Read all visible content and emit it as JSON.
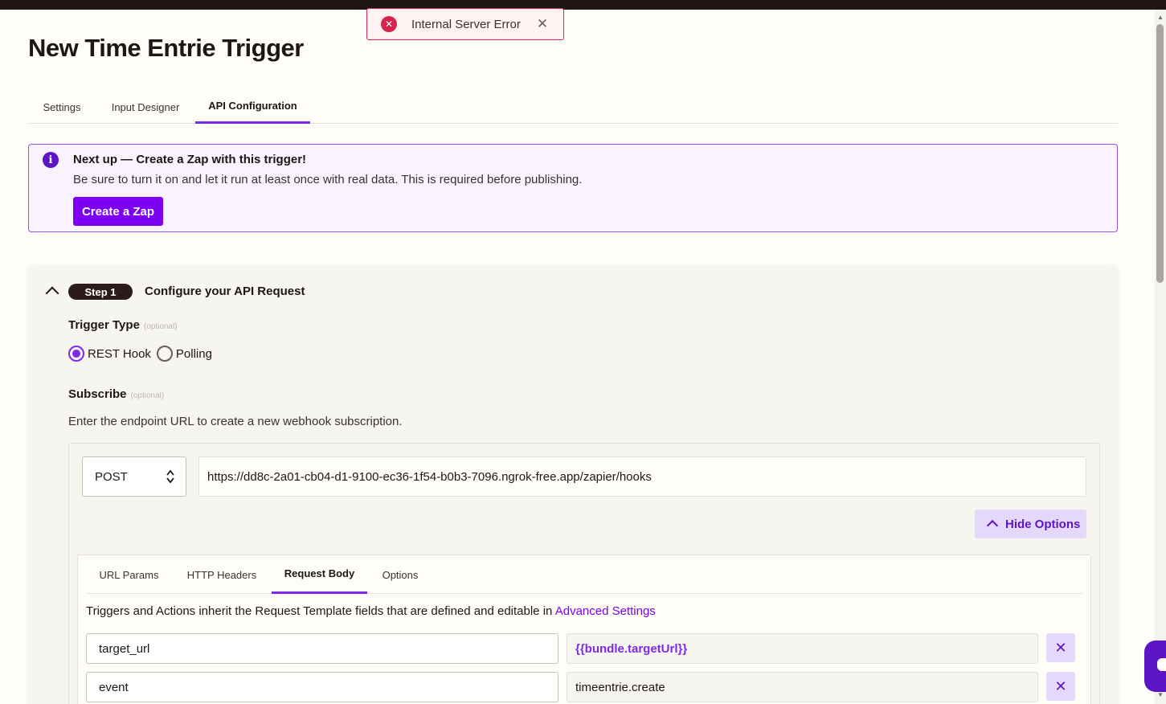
{
  "toast": {
    "message": "Internal Server Error",
    "close": "✕"
  },
  "page": {
    "title": "New Time Entrie Trigger"
  },
  "tabs": [
    {
      "label": "Settings"
    },
    {
      "label": "Input Designer"
    },
    {
      "label": "API Configuration"
    }
  ],
  "banner": {
    "title": "Next up — Create a Zap with this trigger!",
    "text": "Be sure to turn it on and let it run at least once with real data. This is required before publishing.",
    "button": "Create a Zap"
  },
  "step": {
    "badge": "Step 1",
    "title": "Configure your API Request",
    "trigger_type_label": "Trigger Type",
    "optional": "(optional)",
    "radio_options": [
      {
        "label": "REST Hook",
        "checked": true
      },
      {
        "label": "Polling",
        "checked": false
      }
    ],
    "subscribe_label": "Subscribe",
    "subscribe_desc": "Enter the endpoint URL to create a new webhook subscription."
  },
  "request": {
    "method": "POST",
    "url": "https://dd8c-2a01-cb04-d1-9100-ec36-1f54-b0b3-7096.ngrok-free.app/zapier/hooks",
    "hide_options": "Hide Options",
    "tabs": [
      {
        "label": "URL Params"
      },
      {
        "label": "HTTP Headers"
      },
      {
        "label": "Request Body"
      },
      {
        "label": "Options"
      }
    ],
    "inherit_text": "Triggers and Actions inherit the Request Template fields that are defined and editable in ",
    "inherit_link": "Advanced Settings",
    "body_fields": [
      {
        "key": "target_url",
        "value": "{{bundle.targetUrl}}"
      },
      {
        "key": "event",
        "value": "timeentrie.create"
      }
    ],
    "delete_icon": "✕"
  }
}
